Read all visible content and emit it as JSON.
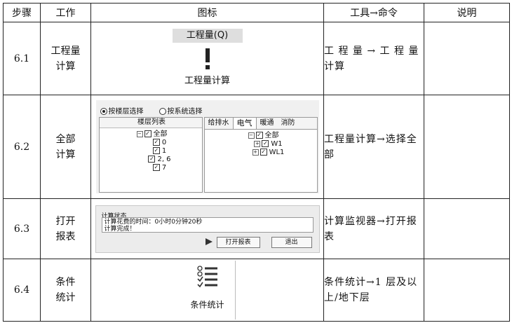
{
  "header": {
    "step": "步骤",
    "work": "工作",
    "icon": "图标",
    "tool": "工具→命令",
    "note": "说明"
  },
  "rows": [
    {
      "step": "6.1",
      "work": [
        "工程量",
        "计算"
      ],
      "tool": "工 程 量 → 工 程 量 计算",
      "note": ""
    },
    {
      "step": "6.2",
      "work": [
        "全部",
        "计算"
      ],
      "tool": "工程量计算→选择全部",
      "note": ""
    },
    {
      "step": "6.3",
      "work": [
        "打开",
        "报表"
      ],
      "tool": "计算监视器→打开报表",
      "note": ""
    },
    {
      "step": "6.4",
      "work": [
        "条件",
        "统计"
      ],
      "tool": "条件统计→1 层及以上/地下层",
      "note": ""
    }
  ],
  "fig61": {
    "ribbon_title": "工程量(Q)",
    "button_label": "工程量计算",
    "icon": "exclamation-icon"
  },
  "fig62": {
    "radio_floor": "按楼层选择",
    "radio_system": "按系统选择",
    "floor_list_title": "楼层列表",
    "floor_root": "全部",
    "floors": [
      "0",
      "1",
      "2, 6",
      "7"
    ],
    "tabs": [
      "给排水",
      "电气",
      "暖通",
      "消防"
    ],
    "selected_tab": "电气",
    "system_root": "全部",
    "systems": [
      "W1",
      "WL1"
    ]
  },
  "fig63": {
    "group_title": "计算状态",
    "status_line1": "计算花费的时间：0小时0分钟20秒",
    "status_line2": "计算完成！",
    "open_report_button": "打开报表",
    "exit_button": "退出"
  },
  "fig64": {
    "button_label": "条件统计",
    "icon": "checklist-icon"
  }
}
